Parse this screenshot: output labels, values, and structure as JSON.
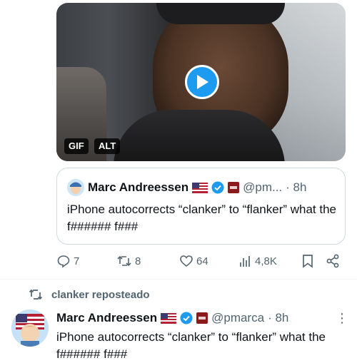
{
  "media": {
    "gif_label": "GIF",
    "alt_label": "ALT"
  },
  "quoted_tweet": {
    "author_name": "Marc Andreessen",
    "handle": "@pm...",
    "time": "· 8h",
    "text": "iPhone autocorrects “clanker” to “flanker” what the f###### f###"
  },
  "actions": {
    "replies": "7",
    "reposts": "8",
    "likes": "64",
    "views": "4,8K"
  },
  "repost_banner": {
    "text": "clanker reposteado"
  },
  "tweet": {
    "author_name": "Marc Andreessen",
    "handle": "@pmarca",
    "time": "· 8h",
    "more": "⋮",
    "text": "iPhone autocorrects “clanker” to “flanker” what the f###### f###"
  },
  "colors": {
    "accent": "#1d9bf0",
    "muted": "#536471",
    "border": "#cfd9de"
  }
}
